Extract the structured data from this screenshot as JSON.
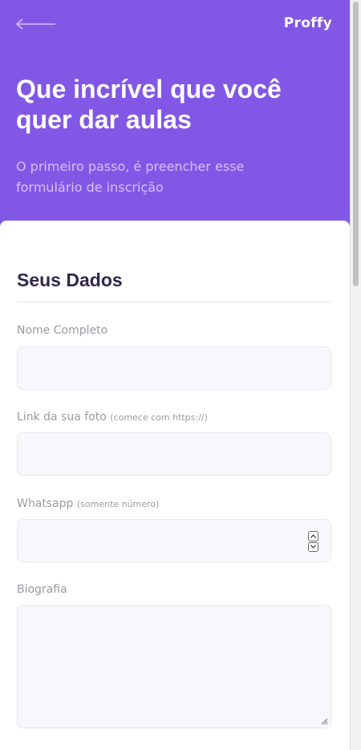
{
  "header": {
    "logo": "Proffy",
    "title": "Que incrível que você quer dar aulas",
    "subtitle": "O primeiro passo, é preencher esse formulário de inscrição"
  },
  "form": {
    "section_title": "Seus Dados",
    "fields": [
      {
        "label": "Nome Completo",
        "hint": "",
        "value": "",
        "type": "text"
      },
      {
        "label": "Link da sua foto",
        "hint": "(comece com https://)",
        "value": "",
        "type": "url"
      },
      {
        "label": "Whatsapp",
        "hint": "(somente número)",
        "value": "",
        "type": "number"
      },
      {
        "label": "Biografia",
        "hint": "",
        "value": "",
        "type": "textarea"
      }
    ]
  },
  "colors": {
    "primary": "#8257e5",
    "title_text": "#32264d",
    "label_text": "#9c98a6",
    "input_bg": "#f8f8fc"
  },
  "icons": {
    "back": "arrow-left-icon",
    "spinner_up": "chevron-up-icon",
    "spinner_down": "chevron-down-icon",
    "resize": "resize-grip-icon"
  }
}
